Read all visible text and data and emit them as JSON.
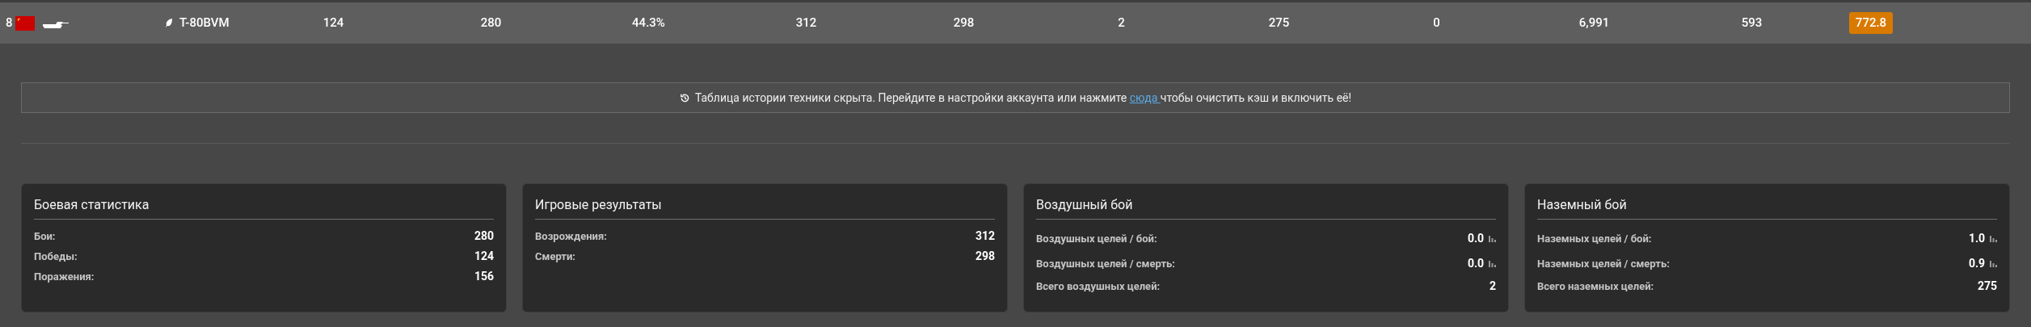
{
  "vehicle_row": {
    "rank": "8",
    "name": "T-80BVM",
    "cells": [
      "124",
      "280",
      "44.3%",
      "312",
      "298",
      "2",
      "275",
      "0",
      "6,991",
      "593"
    ],
    "score": "772.8"
  },
  "notice": {
    "before": "Таблица истории техники скрыта. Перейдите в настройки аккаунта или нажмите",
    "link": "сюда",
    "after": "чтобы очистить кэш и включить её!"
  },
  "cards": [
    {
      "title": "Боевая статистика",
      "rows": [
        {
          "label": "Бои:",
          "value": "280",
          "kind": "plain"
        },
        {
          "label": "Победы:",
          "value": "124",
          "kind": "plain"
        },
        {
          "label": "Поражения:",
          "value": "156",
          "kind": "plain"
        }
      ]
    },
    {
      "title": "Игровые результаты",
      "rows": [
        {
          "label": "Возрождения:",
          "value": "312",
          "kind": "plain"
        },
        {
          "label": "Смерти:",
          "value": "298",
          "kind": "plain"
        }
      ]
    },
    {
      "title": "Воздушный бой",
      "rows": [
        {
          "label": "Воздушных целей / бой:",
          "value": "0.0",
          "kind": "chart"
        },
        {
          "label": "Воздушных целей / смерть:",
          "value": "0.0",
          "kind": "chart"
        },
        {
          "label": "Всего воздушных целей:",
          "value": "2",
          "kind": "plain"
        }
      ]
    },
    {
      "title": "Наземный бой",
      "rows": [
        {
          "label": "Наземных целей / бой:",
          "value": "1.0",
          "kind": "chart"
        },
        {
          "label": "Наземных целей / смерть:",
          "value": "0.9",
          "kind": "chart"
        },
        {
          "label": "Всего наземных целей:",
          "value": "275",
          "kind": "plain"
        }
      ]
    }
  ]
}
